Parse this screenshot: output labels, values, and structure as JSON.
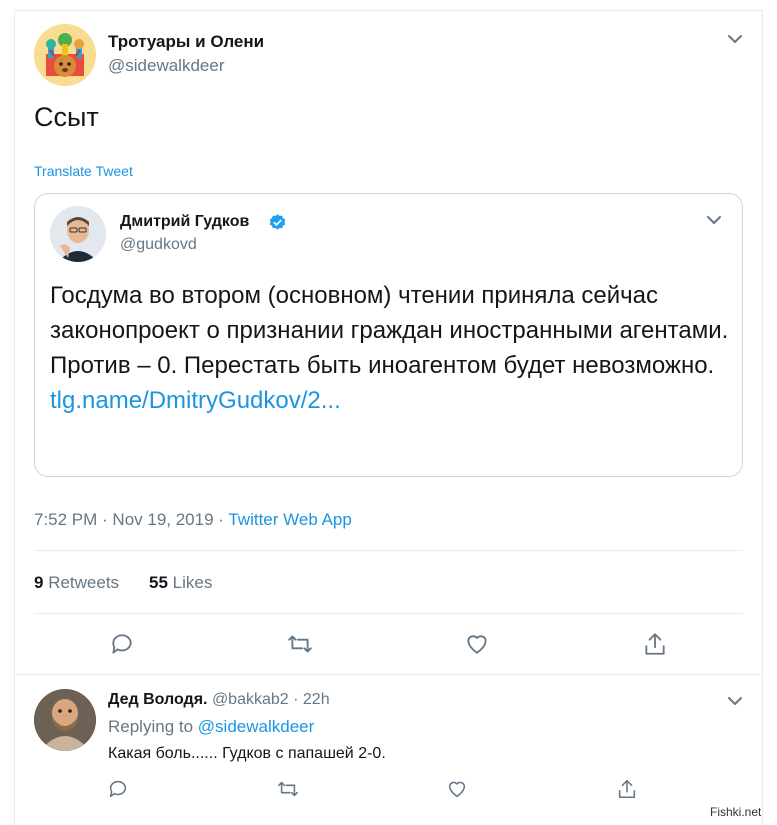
{
  "main_tweet": {
    "author_name": "Тротуары и Олени",
    "author_handle": "@sidewalkdeer",
    "text": "Ссыт",
    "translate_label": "Translate Tweet",
    "timestamp": "7:52 PM · Nov 19, 2019 · ",
    "source": "Twitter Web App",
    "retweets_count": "9",
    "retweets_label": " Retweets",
    "likes_count": "55",
    "likes_label": " Likes"
  },
  "quoted_tweet": {
    "author_name": "Дмитрий Гудков",
    "author_handle": "@gudkovd",
    "verified": true,
    "text": "Госдума во втором (основном) чтении приняла сейчас законопроект о признании граждан иностранными агентами. Против – 0. Перестать быть иноагентом будет невозможно.",
    "link": "tlg.name/DmitryGudkov/2..."
  },
  "reply": {
    "author_name": "Дед Володя.",
    "author_handle": "@bakkab2",
    "separator": " · ",
    "time": "22h",
    "replying_prefix": "Replying to ",
    "replying_to": "@sidewalkdeer",
    "text": "Какая боль...... Гудков с папашей 2-0."
  },
  "watermark": "Fishki.net",
  "colors": {
    "accent": "#1b95e0",
    "secondary_text": "#657786",
    "border": "#e6ecf0"
  },
  "icons": [
    "chevron-down-icon",
    "verified-badge-icon",
    "reply-icon",
    "retweet-icon",
    "like-icon",
    "share-icon"
  ]
}
